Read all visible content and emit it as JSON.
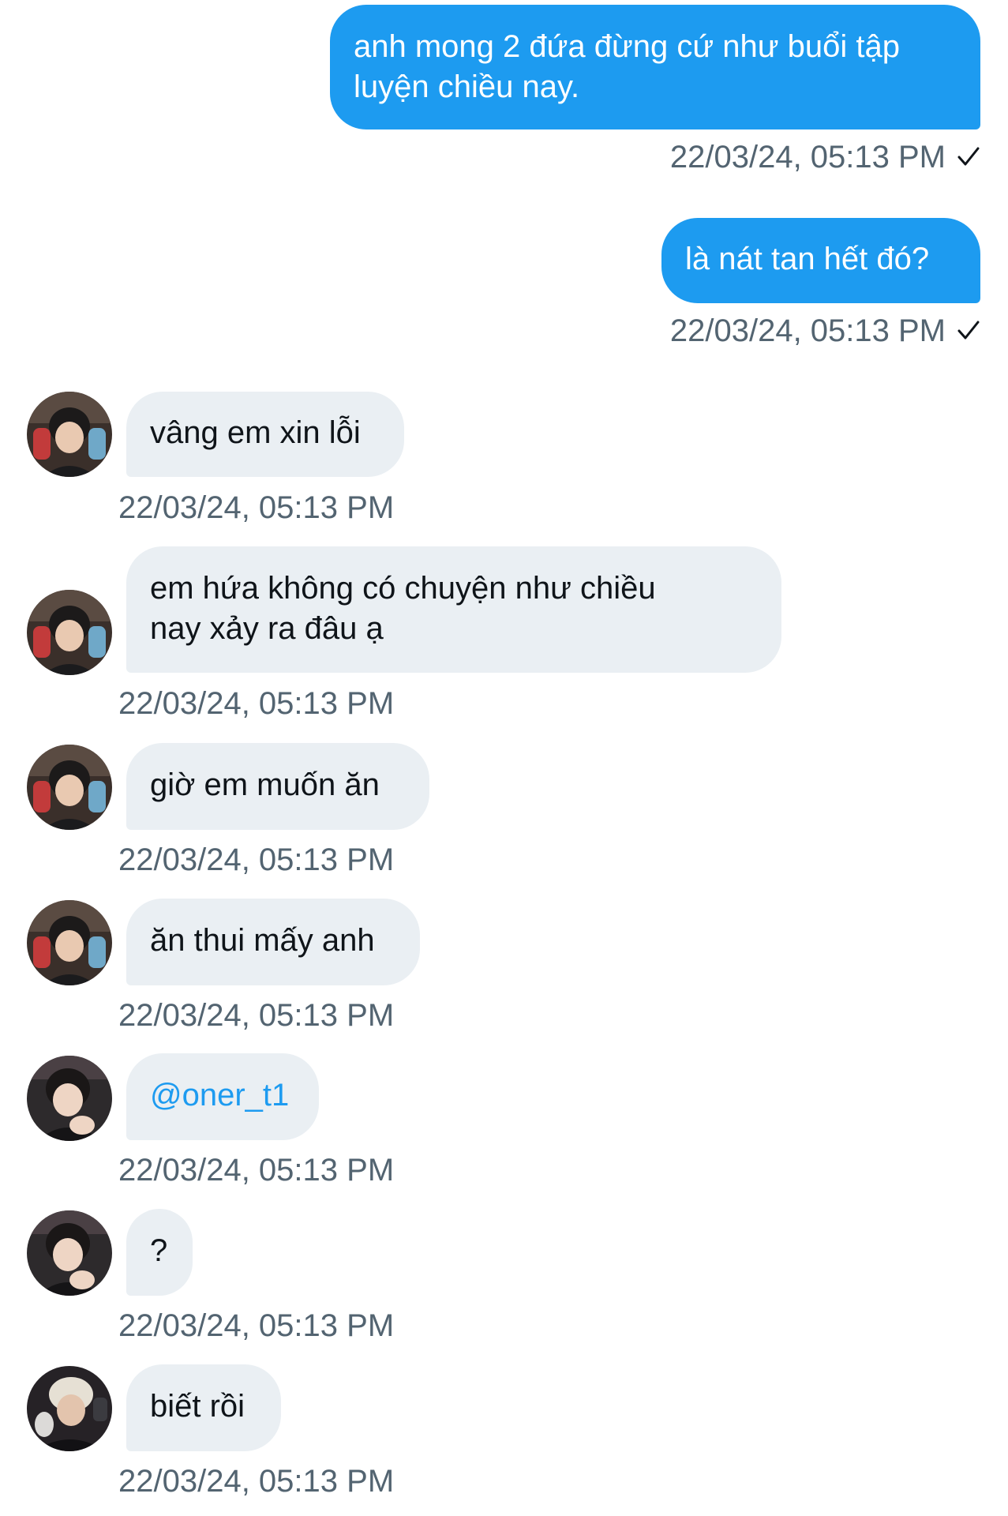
{
  "messages": [
    {
      "dir": "out",
      "text": "anh mong 2 đứa đừng cứ như buổi tập\nluyện chiều nay.",
      "time": "22/03/24, 05:13 PM",
      "icon": "checkmark-icon"
    },
    {
      "dir": "out",
      "text": "là nát tan hết đó?",
      "time": "22/03/24, 05:13 PM",
      "icon": "checkmark-icon"
    },
    {
      "dir": "in",
      "text": "vâng em xin lỗi",
      "time": "22/03/24, 05:13 PM"
    },
    {
      "dir": "in",
      "text": "em hứa không có chuyện như chiều\nnay xảy ra đâu ạ",
      "time": "22/03/24, 05:13 PM"
    },
    {
      "dir": "in",
      "text": "giờ em muốn ăn",
      "time": "22/03/24, 05:13 PM"
    },
    {
      "dir": "in",
      "text": "ăn thui mấy anh",
      "time": "22/03/24, 05:13 PM"
    },
    {
      "dir": "in",
      "text": "@oner_t1",
      "time": "22/03/24, 05:13 PM"
    },
    {
      "dir": "in",
      "text": "?",
      "time": "22/03/24, 05:13 PM"
    },
    {
      "dir": "in",
      "text": "biết rồi",
      "time": "22/03/24, 05:13 PM"
    }
  ],
  "colors": {
    "outgoing_bubble": "#1d9bf0",
    "incoming_bubble": "#eaeff3",
    "timestamp": "#536471",
    "mention": "#1d9bf0"
  }
}
